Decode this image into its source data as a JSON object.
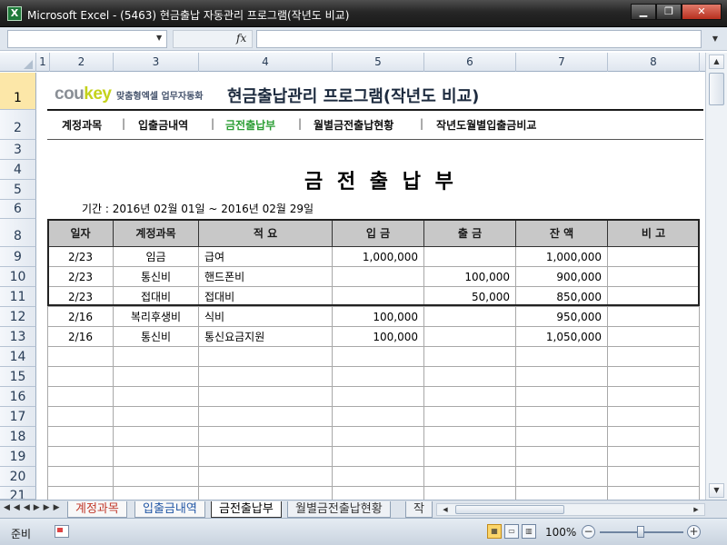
{
  "window": {
    "title": "Microsoft Excel - (5463) 현금출납 자동관리 프로그램(작년도 비교)",
    "app_icon": "excel-icon",
    "controls": [
      "minimize-icon",
      "restore-icon",
      "close-icon"
    ]
  },
  "formula_bar": {
    "name_box": "",
    "fx": "fx",
    "formula": ""
  },
  "columns": [
    "1",
    "2",
    "3",
    "4",
    "5",
    "6",
    "7",
    "8"
  ],
  "rows": [
    "1",
    "2",
    "3",
    "4",
    "5",
    "6",
    "8",
    "9",
    "10",
    "11",
    "12",
    "13",
    "14",
    "15",
    "16",
    "17",
    "18",
    "19",
    "20",
    "21"
  ],
  "header": {
    "brand_main": "cou",
    "brand_key": "key",
    "brand_sub": "맞춤형엑셀 업무자동화",
    "program_title": "현금출납관리 프로그램(작년도 비교)"
  },
  "nav": {
    "items": [
      {
        "label": "계정과목"
      },
      {
        "label": "입출금내역"
      },
      {
        "label": "금전출납부"
      },
      {
        "label": "월별금전출납현황"
      },
      {
        "label": "작년도월별입출금비교"
      }
    ],
    "separator": "|",
    "current": "금전출납부"
  },
  "ledger": {
    "title": "금 전 출 납 부",
    "period": "기간 :  2016년 02월 01일 ~ 2016년 02월 29일",
    "headers": [
      "일자",
      "계정과목",
      "적 요",
      "입 금",
      "출 금",
      "잔 액",
      "비 고"
    ],
    "rows": [
      [
        "2/23",
        "임금",
        "급여",
        "1,000,000",
        "",
        "1,000,000",
        ""
      ],
      [
        "2/23",
        "통신비",
        "핸드폰비",
        "",
        "100,000",
        "900,000",
        ""
      ],
      [
        "2/23",
        "접대비",
        "접대비",
        "",
        "50,000",
        "850,000",
        ""
      ],
      [
        "2/16",
        "복리후생비",
        "식비",
        "100,000",
        "",
        "950,000",
        ""
      ],
      [
        "2/16",
        "통신비",
        "통신요금지원",
        "100,000",
        "",
        "1,050,000",
        ""
      ],
      [
        "",
        "",
        "",
        "",
        "",
        "",
        ""
      ],
      [
        "",
        "",
        "",
        "",
        "",
        "",
        ""
      ],
      [
        "",
        "",
        "",
        "",
        "",
        "",
        ""
      ],
      [
        "",
        "",
        "",
        "",
        "",
        "",
        ""
      ],
      [
        "",
        "",
        "",
        "",
        "",
        "",
        ""
      ],
      [
        "",
        "",
        "",
        "",
        "",
        "",
        ""
      ],
      [
        "",
        "",
        "",
        "",
        "",
        "",
        ""
      ],
      [
        "",
        "",
        "",
        "",
        "",
        "",
        ""
      ]
    ]
  },
  "sheet_tabs": [
    {
      "label": "계정과목",
      "style": "t-red"
    },
    {
      "label": "입출금내역",
      "style": "t-blue"
    },
    {
      "label": "금전출납부",
      "style": "active"
    },
    {
      "label": "월별금전출납현황",
      "style": "t-plain"
    },
    {
      "label": "작",
      "style": "t-plain"
    }
  ],
  "status": {
    "ready": "준비",
    "zoom": "100%",
    "zoom_minus": "−",
    "zoom_plus": "+"
  }
}
